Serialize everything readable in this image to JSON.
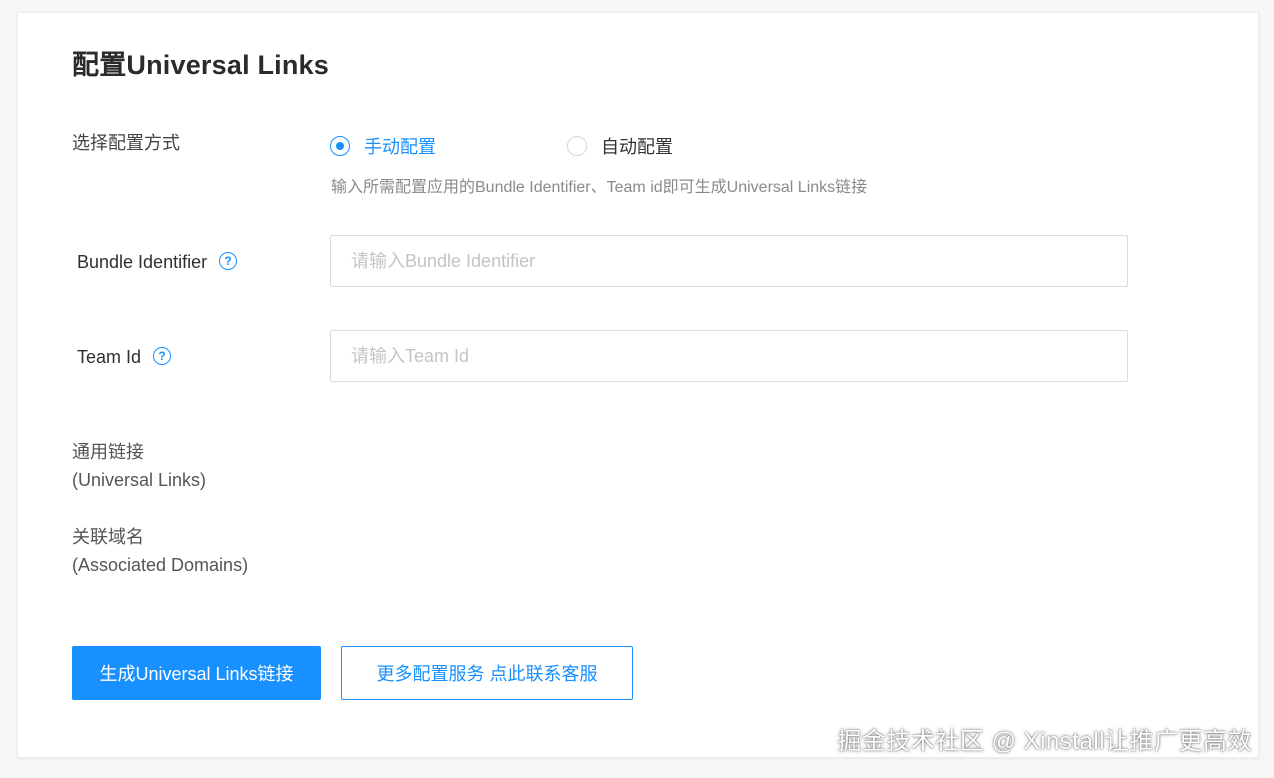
{
  "title": "配置Universal Links",
  "config_mode": {
    "label": "选择配置方式",
    "options": [
      {
        "label": "手动配置",
        "selected": true
      },
      {
        "label": "自动配置",
        "selected": false
      }
    ],
    "hint": "输入所需配置应用的Bundle Identifier、Team id即可生成Universal Links链接"
  },
  "bundle_identifier": {
    "label": "Bundle Identifier",
    "help_icon": "?",
    "placeholder": "请输入Bundle Identifier",
    "value": ""
  },
  "team_id": {
    "label": "Team Id",
    "help_icon": "?",
    "placeholder": "请输入Team Id",
    "value": ""
  },
  "universal_links": {
    "label_line1": "通用链接",
    "label_line2": "(Universal Links)"
  },
  "associated_domains": {
    "label_line1": "关联域名",
    "label_line2": "(Associated Domains)"
  },
  "buttons": {
    "generate": "生成Universal Links链接",
    "more_services": "更多配置服务 点此联系客服"
  },
  "watermark": "掘金技术社区 @ Xinstall让推广更高效",
  "colors": {
    "accent": "#1890ff",
    "text": "#333333",
    "hint": "#8a8a8a",
    "border": "#dcdcdc"
  }
}
